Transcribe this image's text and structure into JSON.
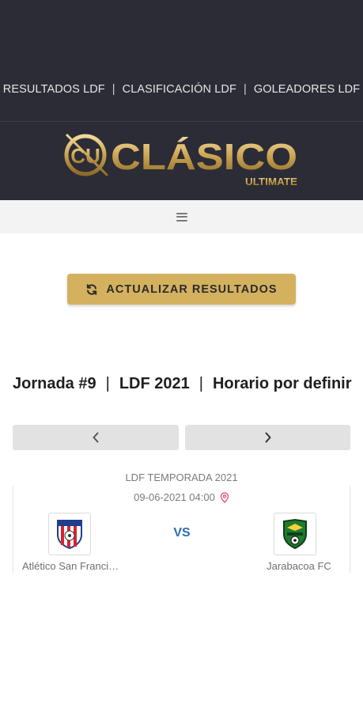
{
  "nav": {
    "items": [
      "RESULTADOS LDF",
      "CLASIFICACIÓN LDF",
      "GOLEADORES LDF"
    ],
    "separator": "|"
  },
  "logo": {
    "main": "CLÁSICO",
    "sub": "ULTIMATE",
    "emblem": "CU"
  },
  "colors": {
    "header_bg": "#2b2c36",
    "accent_gold": "#d4b15e",
    "vs_blue": "#2d6bb3",
    "pin_red": "#e0566b"
  },
  "actions": {
    "refresh_label": "ACTUALIZAR RESULTADOS",
    "refresh_icon": "refresh-icon"
  },
  "round": {
    "jornada": "Jornada #9",
    "separator": "|",
    "league": "LDF 2021",
    "schedule": "Horario por definir"
  },
  "pager": {
    "prev_icon": "chevron-left-icon",
    "next_icon": "chevron-right-icon"
  },
  "match": {
    "season": "LDF TEMPORADA 2021",
    "datetime": "09-06-2021 04:00",
    "location_icon": "map-pin-icon",
    "vs": "VS",
    "home_team": "Atlético San Francisco",
    "away_team": "Jarabacoa FC"
  }
}
